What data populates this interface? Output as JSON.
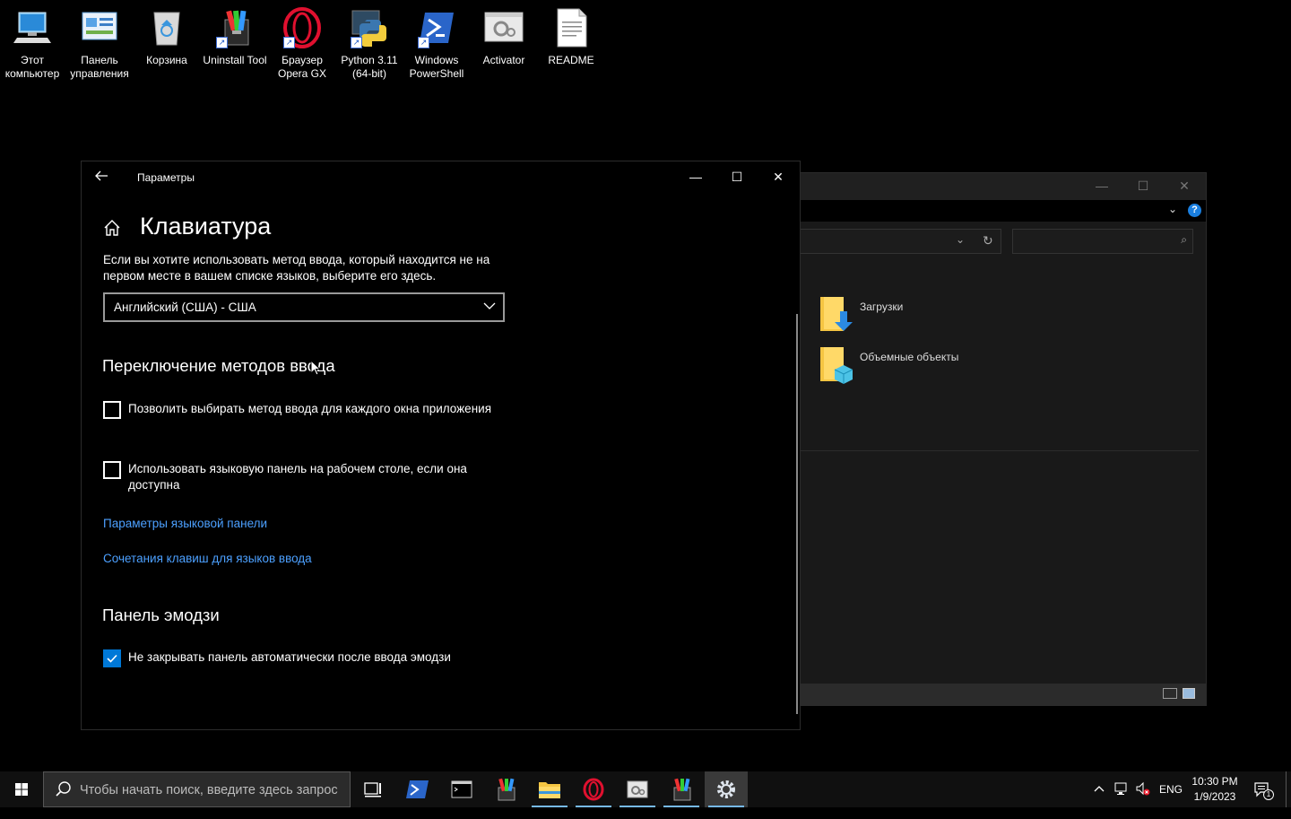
{
  "desktop": {
    "icons": [
      {
        "label1": "Этот",
        "label2": "компьютер"
      },
      {
        "label1": "Панель",
        "label2": "управления"
      },
      {
        "label1": "Корзина",
        "label2": ""
      },
      {
        "label1": "Uninstall Tool",
        "label2": ""
      },
      {
        "label1": "Браузер",
        "label2": "Opera GX"
      },
      {
        "label1": "Python 3.11",
        "label2": "(64-bit)"
      },
      {
        "label1": "Windows",
        "label2": "PowerShell"
      },
      {
        "label1": "Activator",
        "label2": ""
      },
      {
        "label1": "README",
        "label2": ""
      }
    ]
  },
  "explorer": {
    "items": [
      {
        "label": "Загрузки"
      },
      {
        "label": "Объемные объекты"
      }
    ]
  },
  "settings": {
    "window_title": "Параметры",
    "page_title": "Клавиатура",
    "description": "Если вы хотите использовать метод ввода, который находится не на первом месте в вашем списке языков, выберите его здесь.",
    "input_method_value": "Английский (США) - США",
    "section_switch": "Переключение методов ввода",
    "checkbox_per_app": {
      "label": "Позволить выбирать метод ввода для каждого окна приложения",
      "checked": false
    },
    "checkbox_langbar": {
      "label": "Использовать языковую панель на рабочем столе, если она доступна",
      "checked": false
    },
    "link_langbar_options": "Параметры языковой панели",
    "link_hotkeys": "Сочетания клавиш для языков ввода",
    "section_emoji": "Панель эмодзи",
    "checkbox_emoji": {
      "label": "Не закрывать панель автоматически после ввода эмодзи",
      "checked": true
    }
  },
  "taskbar": {
    "search_placeholder": "Чтобы начать поиск, введите здесь запрос",
    "language": "ENG",
    "time": "10:30 PM",
    "date": "1/9/2023",
    "notification_count": "1"
  },
  "colors": {
    "accent": "#0078d7",
    "link": "#4ca0ff"
  }
}
